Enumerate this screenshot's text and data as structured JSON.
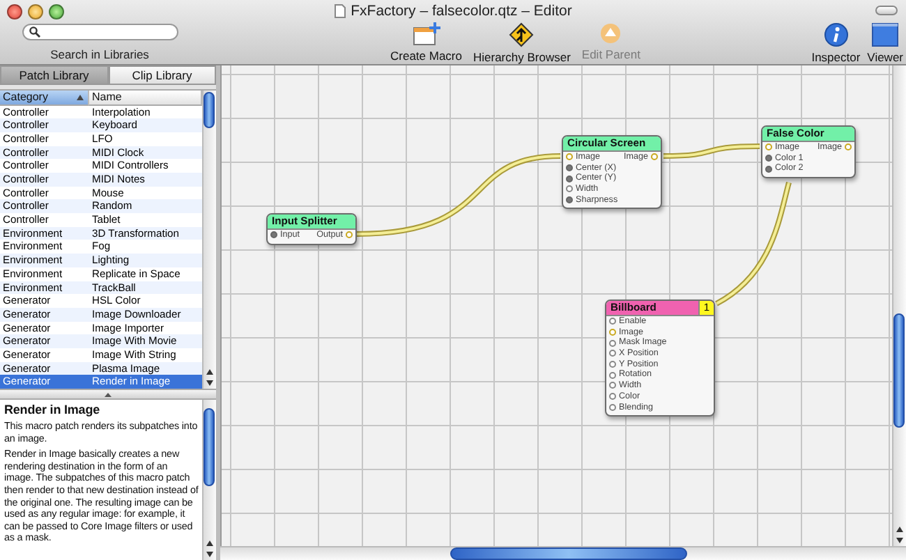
{
  "window": {
    "title": "FxFactory – falsecolor.qtz – Editor"
  },
  "toolbar": {
    "search": {
      "label": "Search in Libraries"
    },
    "buttons": [
      {
        "label": "Create Macro",
        "disabled": false
      },
      {
        "label": "Hierarchy Browser",
        "disabled": false
      },
      {
        "label": "Edit Parent",
        "disabled": true
      },
      {
        "label": "Inspector",
        "disabled": false
      },
      {
        "label": "Viewer",
        "disabled": false
      }
    ]
  },
  "library_tabs": [
    {
      "label": "Patch Library",
      "selected": true
    },
    {
      "label": "Clip Library",
      "selected": false
    }
  ],
  "table": {
    "columns": [
      {
        "label": "Category",
        "sorted": true
      },
      {
        "label": "Name",
        "sorted": false
      }
    ],
    "rows": [
      {
        "category": "Controller",
        "name": "Interpolation",
        "selected": false
      },
      {
        "category": "Controller",
        "name": "Keyboard",
        "selected": false
      },
      {
        "category": "Controller",
        "name": "LFO",
        "selected": false
      },
      {
        "category": "Controller",
        "name": "MIDI Clock",
        "selected": false
      },
      {
        "category": "Controller",
        "name": "MIDI Controllers",
        "selected": false
      },
      {
        "category": "Controller",
        "name": "MIDI Notes",
        "selected": false
      },
      {
        "category": "Controller",
        "name": "Mouse",
        "selected": false
      },
      {
        "category": "Controller",
        "name": "Random",
        "selected": false
      },
      {
        "category": "Controller",
        "name": "Tablet",
        "selected": false
      },
      {
        "category": "Environment",
        "name": "3D Transformation",
        "selected": false
      },
      {
        "category": "Environment",
        "name": "Fog",
        "selected": false
      },
      {
        "category": "Environment",
        "name": "Lighting",
        "selected": false
      },
      {
        "category": "Environment",
        "name": "Replicate in Space",
        "selected": false
      },
      {
        "category": "Environment",
        "name": "TrackBall",
        "selected": false
      },
      {
        "category": "Generator",
        "name": "HSL Color",
        "selected": false
      },
      {
        "category": "Generator",
        "name": "Image Downloader",
        "selected": false
      },
      {
        "category": "Generator",
        "name": "Image Importer",
        "selected": false
      },
      {
        "category": "Generator",
        "name": "Image With Movie",
        "selected": false
      },
      {
        "category": "Generator",
        "name": "Image With String",
        "selected": false
      },
      {
        "category": "Generator",
        "name": "Plasma Image",
        "selected": false
      },
      {
        "category": "Generator",
        "name": "Render in Image",
        "selected": true
      }
    ]
  },
  "description": {
    "title": "Render in Image",
    "paragraphs": [
      "This macro patch renders its subpatches into an image.",
      "Render in Image basically creates a new rendering destination in the form of an image. The subpatches of this macro patch then render to that new destination instead of the original one. The resulting image can be used as any regular image: for example, it can be passed to Core Image filters or used as a mask."
    ]
  },
  "editor": {
    "patches": [
      {
        "title": "Input Splitter",
        "color": "#72f0a8",
        "inputs": [
          {
            "label": "Input",
            "kind": "filled"
          }
        ],
        "outputs": [
          {
            "label": "Output",
            "kind": "image"
          }
        ]
      },
      {
        "title": "Circular Screen",
        "color": "#72f0a8",
        "inputs": [
          {
            "label": "Image",
            "kind": "image"
          },
          {
            "label": "Center (X)",
            "kind": "filled"
          },
          {
            "label": "Center (Y)",
            "kind": "filled"
          },
          {
            "label": "Width",
            "kind": "hollow"
          },
          {
            "label": "Sharpness",
            "kind": "filled"
          }
        ],
        "outputs": [
          {
            "label": "Image",
            "kind": "image"
          }
        ]
      },
      {
        "title": "False Color",
        "color": "#72f0a8",
        "inputs": [
          {
            "label": "Image",
            "kind": "image"
          },
          {
            "label": "Color 1",
            "kind": "filled"
          },
          {
            "label": "Color 2",
            "kind": "filled"
          }
        ],
        "outputs": [
          {
            "label": "Image",
            "kind": "image"
          }
        ]
      },
      {
        "title": "Billboard",
        "color": "#f062b0",
        "badge": "1",
        "inputs": [
          {
            "label": "Enable",
            "kind": "hollow"
          },
          {
            "label": "Image",
            "kind": "image"
          },
          {
            "label": "Mask Image",
            "kind": "hollow"
          },
          {
            "label": "X Position",
            "kind": "hollow"
          },
          {
            "label": "Y Position",
            "kind": "hollow"
          },
          {
            "label": "Rotation",
            "kind": "hollow"
          },
          {
            "label": "Width",
            "kind": "hollow"
          },
          {
            "label": "Color",
            "kind": "hollow"
          },
          {
            "label": "Blending",
            "kind": "hollow"
          }
        ]
      }
    ]
  }
}
